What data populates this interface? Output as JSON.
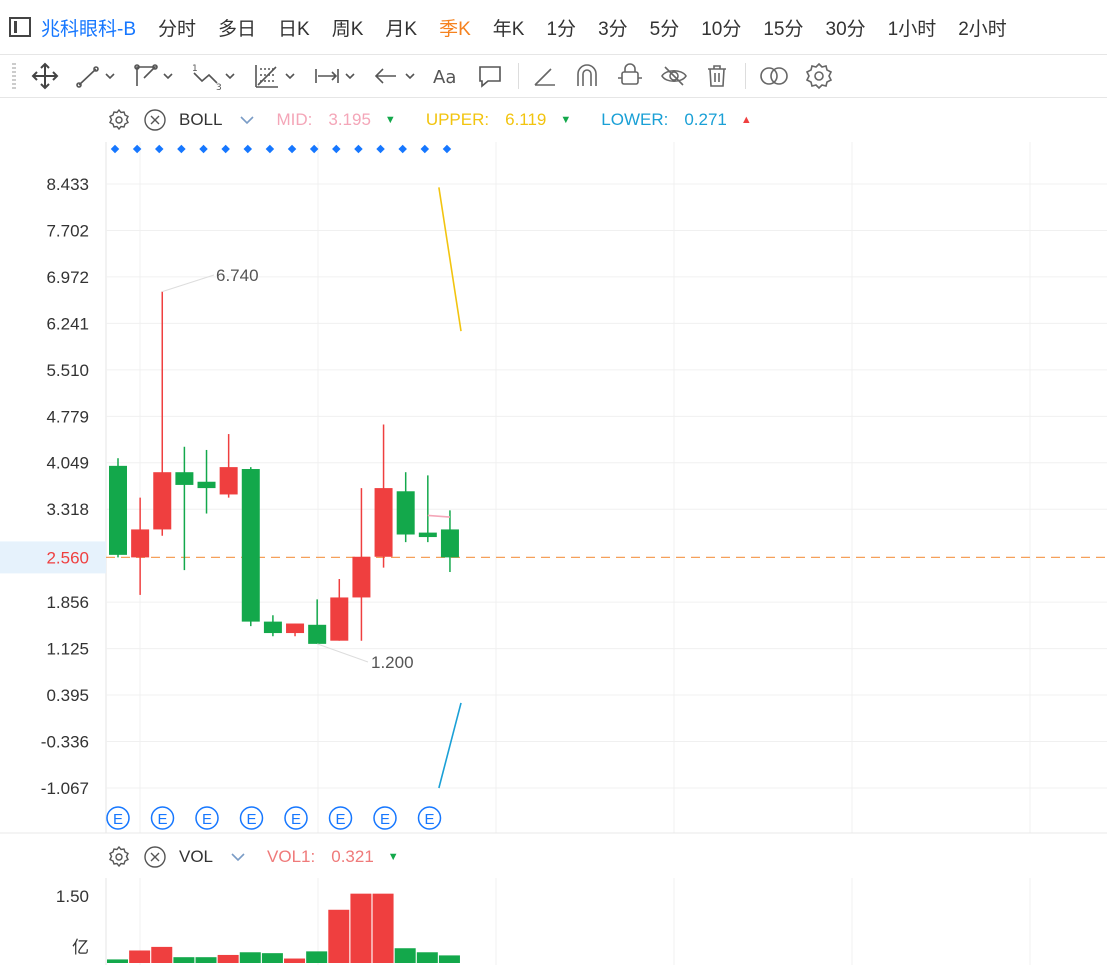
{
  "header": {
    "symbol": "兆科眼科-B",
    "periods": [
      "分时",
      "多日",
      "日K",
      "周K",
      "月K",
      "季K",
      "年K",
      "1分",
      "3分",
      "5分",
      "10分",
      "15分",
      "30分",
      "1小时",
      "2小时"
    ],
    "active_period": "季K"
  },
  "toolbar": {
    "tools": [
      "move-icon",
      "line-icon",
      "polyline-icon",
      "wave-icon",
      "fib-icon",
      "measure-icon",
      "arrow-left-icon",
      "text-icon",
      "comment-icon",
      "angle-icon",
      "magnet-icon",
      "lock-icon",
      "hide-icon",
      "trash-icon",
      "compare-icon",
      "gear-icon"
    ]
  },
  "boll_legend": {
    "name": "BOLL",
    "mid_label": "MID:",
    "mid_value": "3.195",
    "mid_color": "#f4a6b8",
    "mid_trend": "down",
    "upper_label": "UPPER:",
    "upper_value": "6.119",
    "upper_color": "#f2c40f",
    "upper_trend": "down",
    "lower_label": "LOWER:",
    "lower_value": "0.271",
    "lower_color": "#1aa0d6",
    "lower_trend": "up"
  },
  "vol_legend": {
    "name": "VOL",
    "vol1_label": "VOL1:",
    "vol1_value": "0.321",
    "vol1_color": "#ef7a7a",
    "vol1_trend": "down"
  },
  "colors": {
    "up": "#ef3f3f",
    "down": "#13a84b",
    "price_line": "#f5a05a"
  },
  "chart_data": {
    "type": "candlestick",
    "y_ticks": [
      "8.433",
      "7.702",
      "6.972",
      "6.241",
      "5.510",
      "4.779",
      "4.049",
      "3.318",
      "2.560",
      "1.856",
      "1.125",
      "0.395",
      "-0.336",
      "-1.067"
    ],
    "ylim": [
      -1.067,
      8.433
    ],
    "current_price": "2.560",
    "max_label": "6.740",
    "min_label": "1.200",
    "candles": [
      {
        "open": 4.0,
        "high": 4.12,
        "low": 2.56,
        "close": 2.6
      },
      {
        "open": 2.56,
        "high": 3.5,
        "low": 1.97,
        "close": 3.0
      },
      {
        "open": 3.0,
        "high": 6.74,
        "low": 2.9,
        "close": 3.9
      },
      {
        "open": 3.9,
        "high": 4.3,
        "low": 2.36,
        "close": 3.7
      },
      {
        "open": 3.75,
        "high": 4.25,
        "low": 3.25,
        "close": 3.65
      },
      {
        "open": 3.55,
        "high": 4.5,
        "low": 3.5,
        "close": 3.98
      },
      {
        "open": 3.95,
        "high": 3.98,
        "low": 1.48,
        "close": 1.55
      },
      {
        "open": 1.55,
        "high": 1.65,
        "low": 1.32,
        "close": 1.37
      },
      {
        "open": 1.37,
        "high": 1.52,
        "low": 1.32,
        "close": 1.52
      },
      {
        "open": 1.5,
        "high": 1.9,
        "low": 1.2,
        "close": 1.2
      },
      {
        "open": 1.25,
        "high": 2.22,
        "low": 1.25,
        "close": 1.93
      },
      {
        "open": 1.93,
        "high": 3.65,
        "low": 1.25,
        "close": 2.57
      },
      {
        "open": 2.57,
        "high": 4.65,
        "low": 2.4,
        "close": 3.65
      },
      {
        "open": 3.6,
        "high": 3.9,
        "low": 2.8,
        "close": 2.92
      },
      {
        "open": 2.95,
        "high": 3.85,
        "low": 2.8,
        "close": 2.88
      },
      {
        "open": 3.0,
        "high": 3.3,
        "low": 2.33,
        "close": 2.56
      }
    ],
    "boll_mid": [
      {
        "i": 14,
        "v": 3.22
      },
      {
        "i": 15,
        "v": 3.195
      }
    ],
    "boll_upper": [
      {
        "i": 14.5,
        "v": 8.38
      },
      {
        "i": 15.5,
        "v": 6.119
      }
    ],
    "boll_lower": [
      {
        "i": 14.5,
        "v": -1.067
      },
      {
        "i": 15.5,
        "v": 0.271
      }
    ],
    "volume": {
      "unit_label": "亿",
      "tick": "1.50",
      "ylim": [
        0,
        1.9
      ],
      "values": [
        0.08,
        0.28,
        0.36,
        0.13,
        0.13,
        0.18,
        0.24,
        0.22,
        0.1,
        0.26,
        1.19,
        1.55,
        1.55,
        0.33,
        0.24,
        0.17
      ]
    },
    "event_markers": [
      "E",
      "E",
      "E",
      "E",
      "E",
      "E",
      "E",
      "E"
    ]
  }
}
